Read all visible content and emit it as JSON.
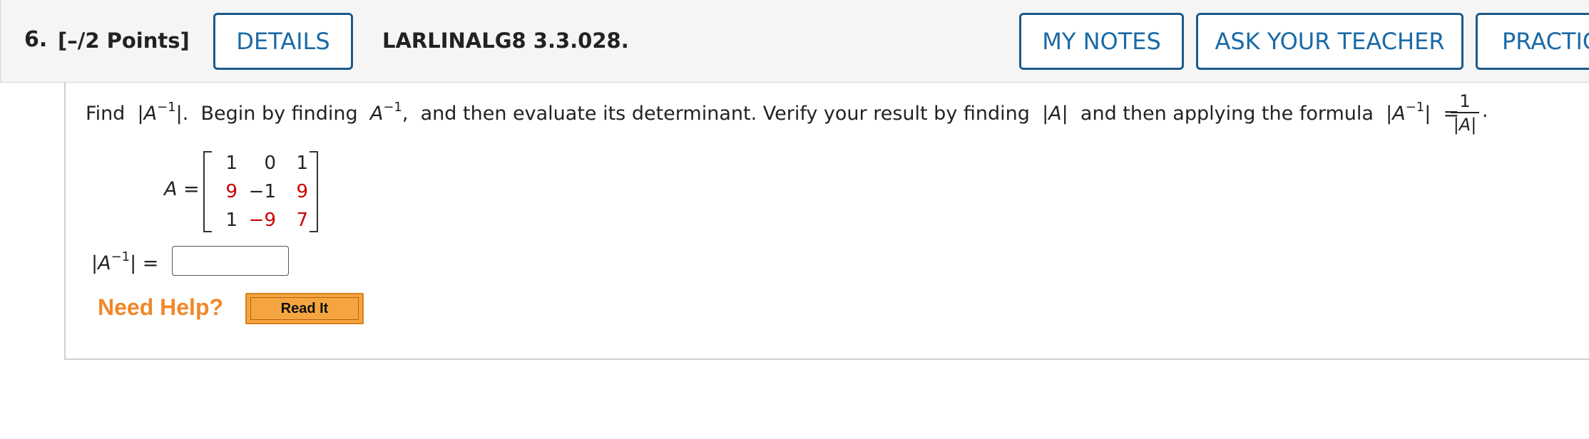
{
  "header": {
    "question_number": "6.",
    "points": "[–/2 Points]",
    "details_label": "DETAILS",
    "problem_code": "LARLINALG8 3.3.028.",
    "my_notes_label": "MY NOTES",
    "ask_teacher_label": "ASK YOUR TEACHER",
    "practice_label": "PRACTIC"
  },
  "prompt": {
    "find": "Find",
    "abs_open": "|A",
    "inv_exp": "−1",
    "abs_close": "|.",
    "begin_text": "Begin by finding",
    "A": "A",
    "after_A_inv": ",",
    "middle_text": "and then evaluate its determinant. Verify your result by finding",
    "abs_A": "|A|",
    "formula_text": "and then applying the formula",
    "formula_lhs_close": "|",
    "equals": "=",
    "frac_num": "1",
    "frac_den": "|A|",
    "period": "."
  },
  "matrix": {
    "label": "A =",
    "rows": [
      [
        {
          "v": "1",
          "red": false
        },
        {
          "v": "0",
          "red": false
        },
        {
          "v": "1",
          "red": false
        }
      ],
      [
        {
          "v": "9",
          "red": true
        },
        {
          "v": "−1",
          "red": false
        },
        {
          "v": "9",
          "red": true
        }
      ],
      [
        {
          "v": "1",
          "red": false
        },
        {
          "v": "−9",
          "red": true
        },
        {
          "v": "7",
          "red": true
        }
      ]
    ]
  },
  "answer": {
    "label_open": "|A",
    "label_exp": "−1",
    "label_close": "| =",
    "value": ""
  },
  "help": {
    "need_help": "Need Help?",
    "read_it": "Read It"
  },
  "colors": {
    "accent_blue": "#1a6aa6",
    "given_red": "#cc0000",
    "help_orange": "#f2872a"
  }
}
